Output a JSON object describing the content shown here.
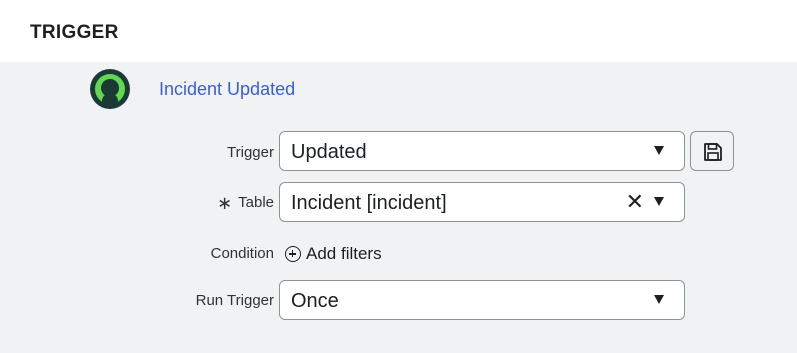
{
  "header": {
    "title": "TRIGGER"
  },
  "trigger": {
    "name": "Incident Updated",
    "icon": "user-circle-icon"
  },
  "fields": {
    "trigger": {
      "label": "Trigger",
      "value": "Updated"
    },
    "table": {
      "required_mark": "∗",
      "label": "Table",
      "value": "Incident [incident]",
      "clear": "✕"
    },
    "condition": {
      "label": "Condition",
      "add_filters": "Add filters"
    },
    "run_trigger": {
      "label": "Run Trigger",
      "value": "Once"
    }
  },
  "colors": {
    "link": "#3b5fd1",
    "icon_dark": "#1b3a36",
    "icon_green": "#62d84e",
    "panel_bg": "#f1f2f3"
  }
}
